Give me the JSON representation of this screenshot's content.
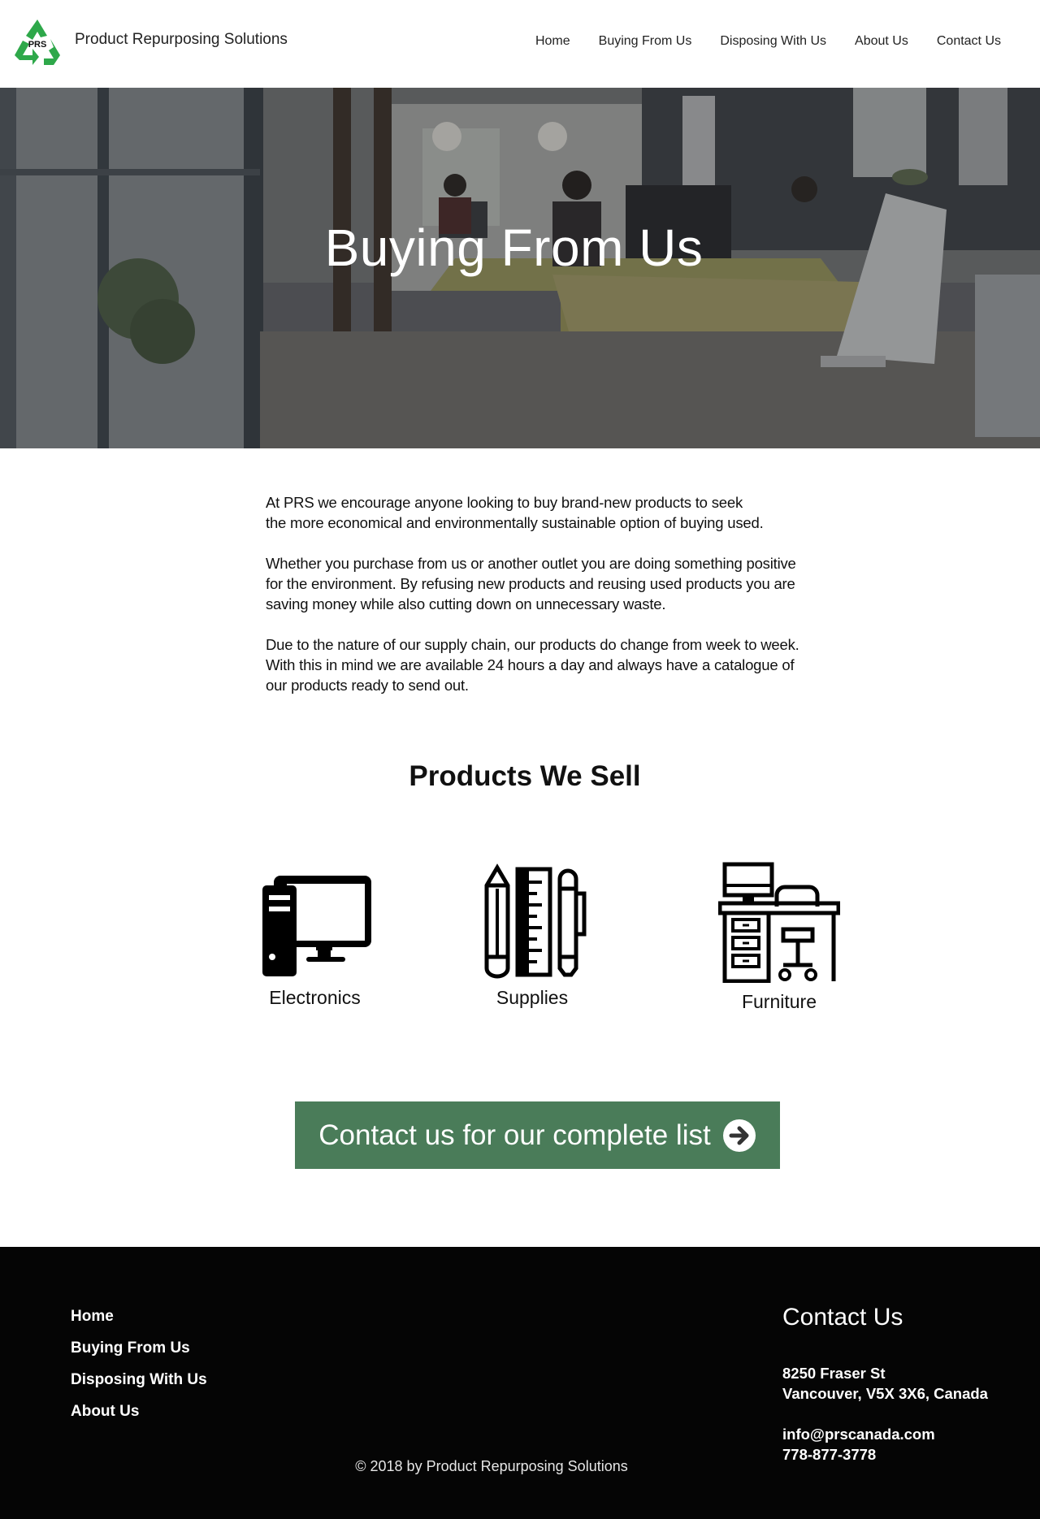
{
  "header": {
    "logo_text": "PRS",
    "brand": "Product Repurposing Solutions",
    "nav": [
      "Home",
      "Buying From Us",
      "Disposing With Us",
      "About Us",
      "Contact Us"
    ]
  },
  "hero": {
    "title": "Buying From Us"
  },
  "intro": {
    "p1": [
      "At PRS we encourage anyone looking to buy brand-new products to seek",
      "the more economical and environmentally sustainable option of buying used."
    ],
    "p2": [
      "Whether you purchase from us or another outlet you are doing something positive",
      "for the environment. By refusing new products and reusing used products you are",
      "saving money while also cutting down on unnecessary waste."
    ],
    "p3": [
      "Due to the nature of our supply chain, our products do change from week to week.",
      "With this in mind we are available 24 hours a day and always have a catalogue of",
      "our products ready to send out."
    ]
  },
  "products": {
    "title": "Products We Sell",
    "items": [
      {
        "label": "Electronics",
        "icon": "computer-icon"
      },
      {
        "label": "Supplies",
        "icon": "stationery-icon"
      },
      {
        "label": "Furniture",
        "icon": "desk-icon"
      }
    ]
  },
  "cta": {
    "label": "Contact us for our complete list",
    "icon": "arrow-right-circle-icon",
    "color": "#4a7c59"
  },
  "footer": {
    "nav": [
      "Home",
      "Buying From Us",
      "Disposing With Us",
      "About Us"
    ],
    "contact_title": "Contact Us",
    "street": "8250 Fraser St",
    "city": "Vancouver, V5X 3X6, Canada",
    "email": "info@prscanada.com",
    "phone": "778-877-3778",
    "copyright": "© 2018  by Product Repurposing Solutions"
  },
  "colors": {
    "brand_green": "#2ea84a",
    "cta_green": "#4a7c59",
    "footer_bg": "#050505"
  }
}
